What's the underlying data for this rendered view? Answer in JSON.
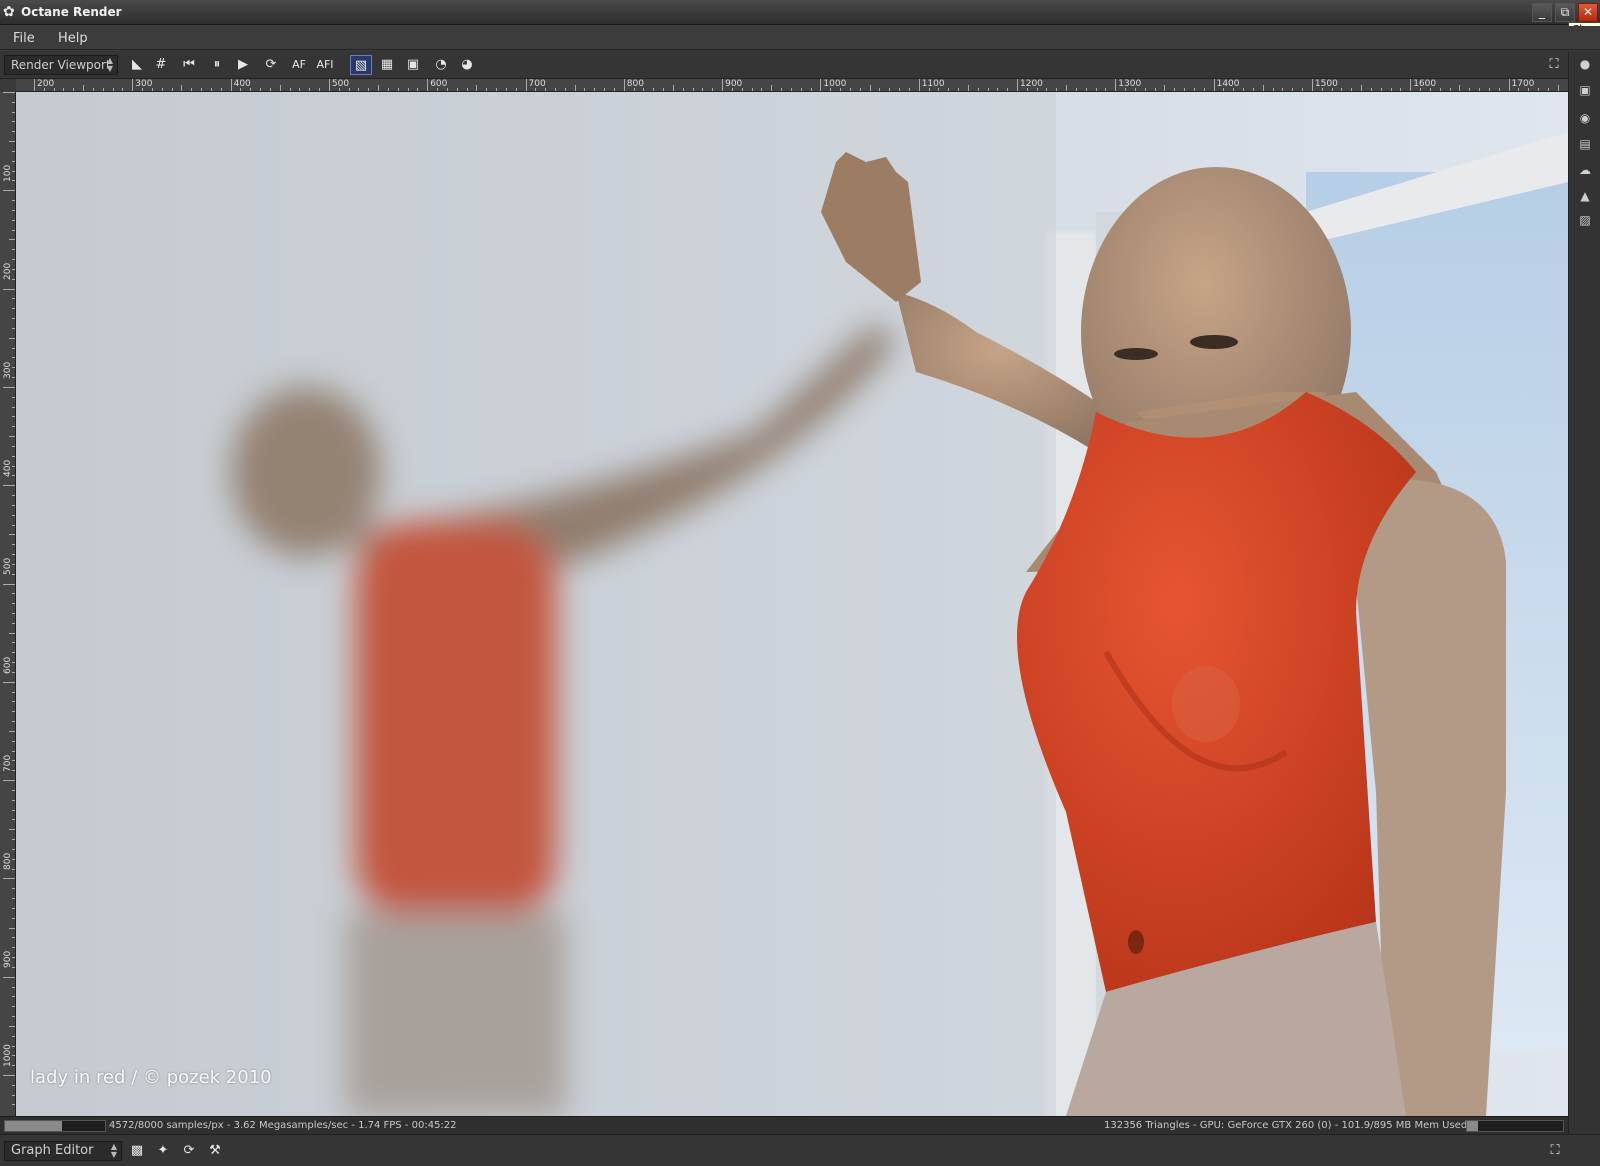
{
  "window": {
    "title": "Octane Render",
    "tooltip": "Close",
    "minimize": "_",
    "maximize": "⧉",
    "close": "✕"
  },
  "menu": {
    "items": [
      "File",
      "Help"
    ]
  },
  "toolbar": {
    "viewport_select": "Render Viewport",
    "buttons": [
      {
        "name": "pick-focus",
        "glyph": "◣"
      },
      {
        "name": "grid",
        "glyph": "#"
      },
      {
        "name": "restart",
        "glyph": "⏮"
      },
      {
        "name": "pause",
        "glyph": "⏸"
      },
      {
        "name": "start",
        "glyph": "▶"
      },
      {
        "name": "refresh",
        "glyph": "⟳"
      },
      {
        "name": "auto-focus",
        "glyph": "AF"
      },
      {
        "name": "auto-focus-i",
        "glyph": "AFI"
      },
      {
        "name": "region-render",
        "glyph": "▧"
      },
      {
        "name": "alpha-checker",
        "glyph": "▦"
      },
      {
        "name": "clay-mode",
        "glyph": "▣"
      },
      {
        "name": "lock-view",
        "glyph": "◔"
      },
      {
        "name": "unlock-view",
        "glyph": "◕"
      }
    ],
    "fullscreen_glyph": "⛶"
  },
  "rulers": {
    "top_labels": [
      "200",
      "300",
      "400",
      "500",
      "600",
      "700",
      "800",
      "900",
      "1000",
      "1100",
      "1200",
      "1300",
      "1400",
      "1500",
      "1600",
      "1700"
    ],
    "left_labels": [
      "100",
      "200",
      "300",
      "400",
      "500",
      "600",
      "700",
      "800",
      "900",
      "1000"
    ]
  },
  "side_icons": [
    "settings-dot",
    "render-target",
    "camera",
    "material",
    "environment",
    "image",
    "kernel"
  ],
  "viewport": {
    "watermark": "lady in red / © pozek 2010"
  },
  "status": {
    "left": "4572/8000 samples/px - 3.62 Megasamples/sec - 1.74 FPS - 00:45:22",
    "right": "132356 Triangles - GPU: GeForce GTX 260 (0) - 101.9/895 MB Mem Used",
    "samples_done": 4572,
    "samples_total": 8000,
    "mem_used": 101.9,
    "mem_total": 895
  },
  "bottom": {
    "editor_select": "Graph Editor"
  },
  "colors": {
    "accent_active": "#2a3a66",
    "close_red": "#c83a18",
    "top_red": "#d0421f"
  }
}
